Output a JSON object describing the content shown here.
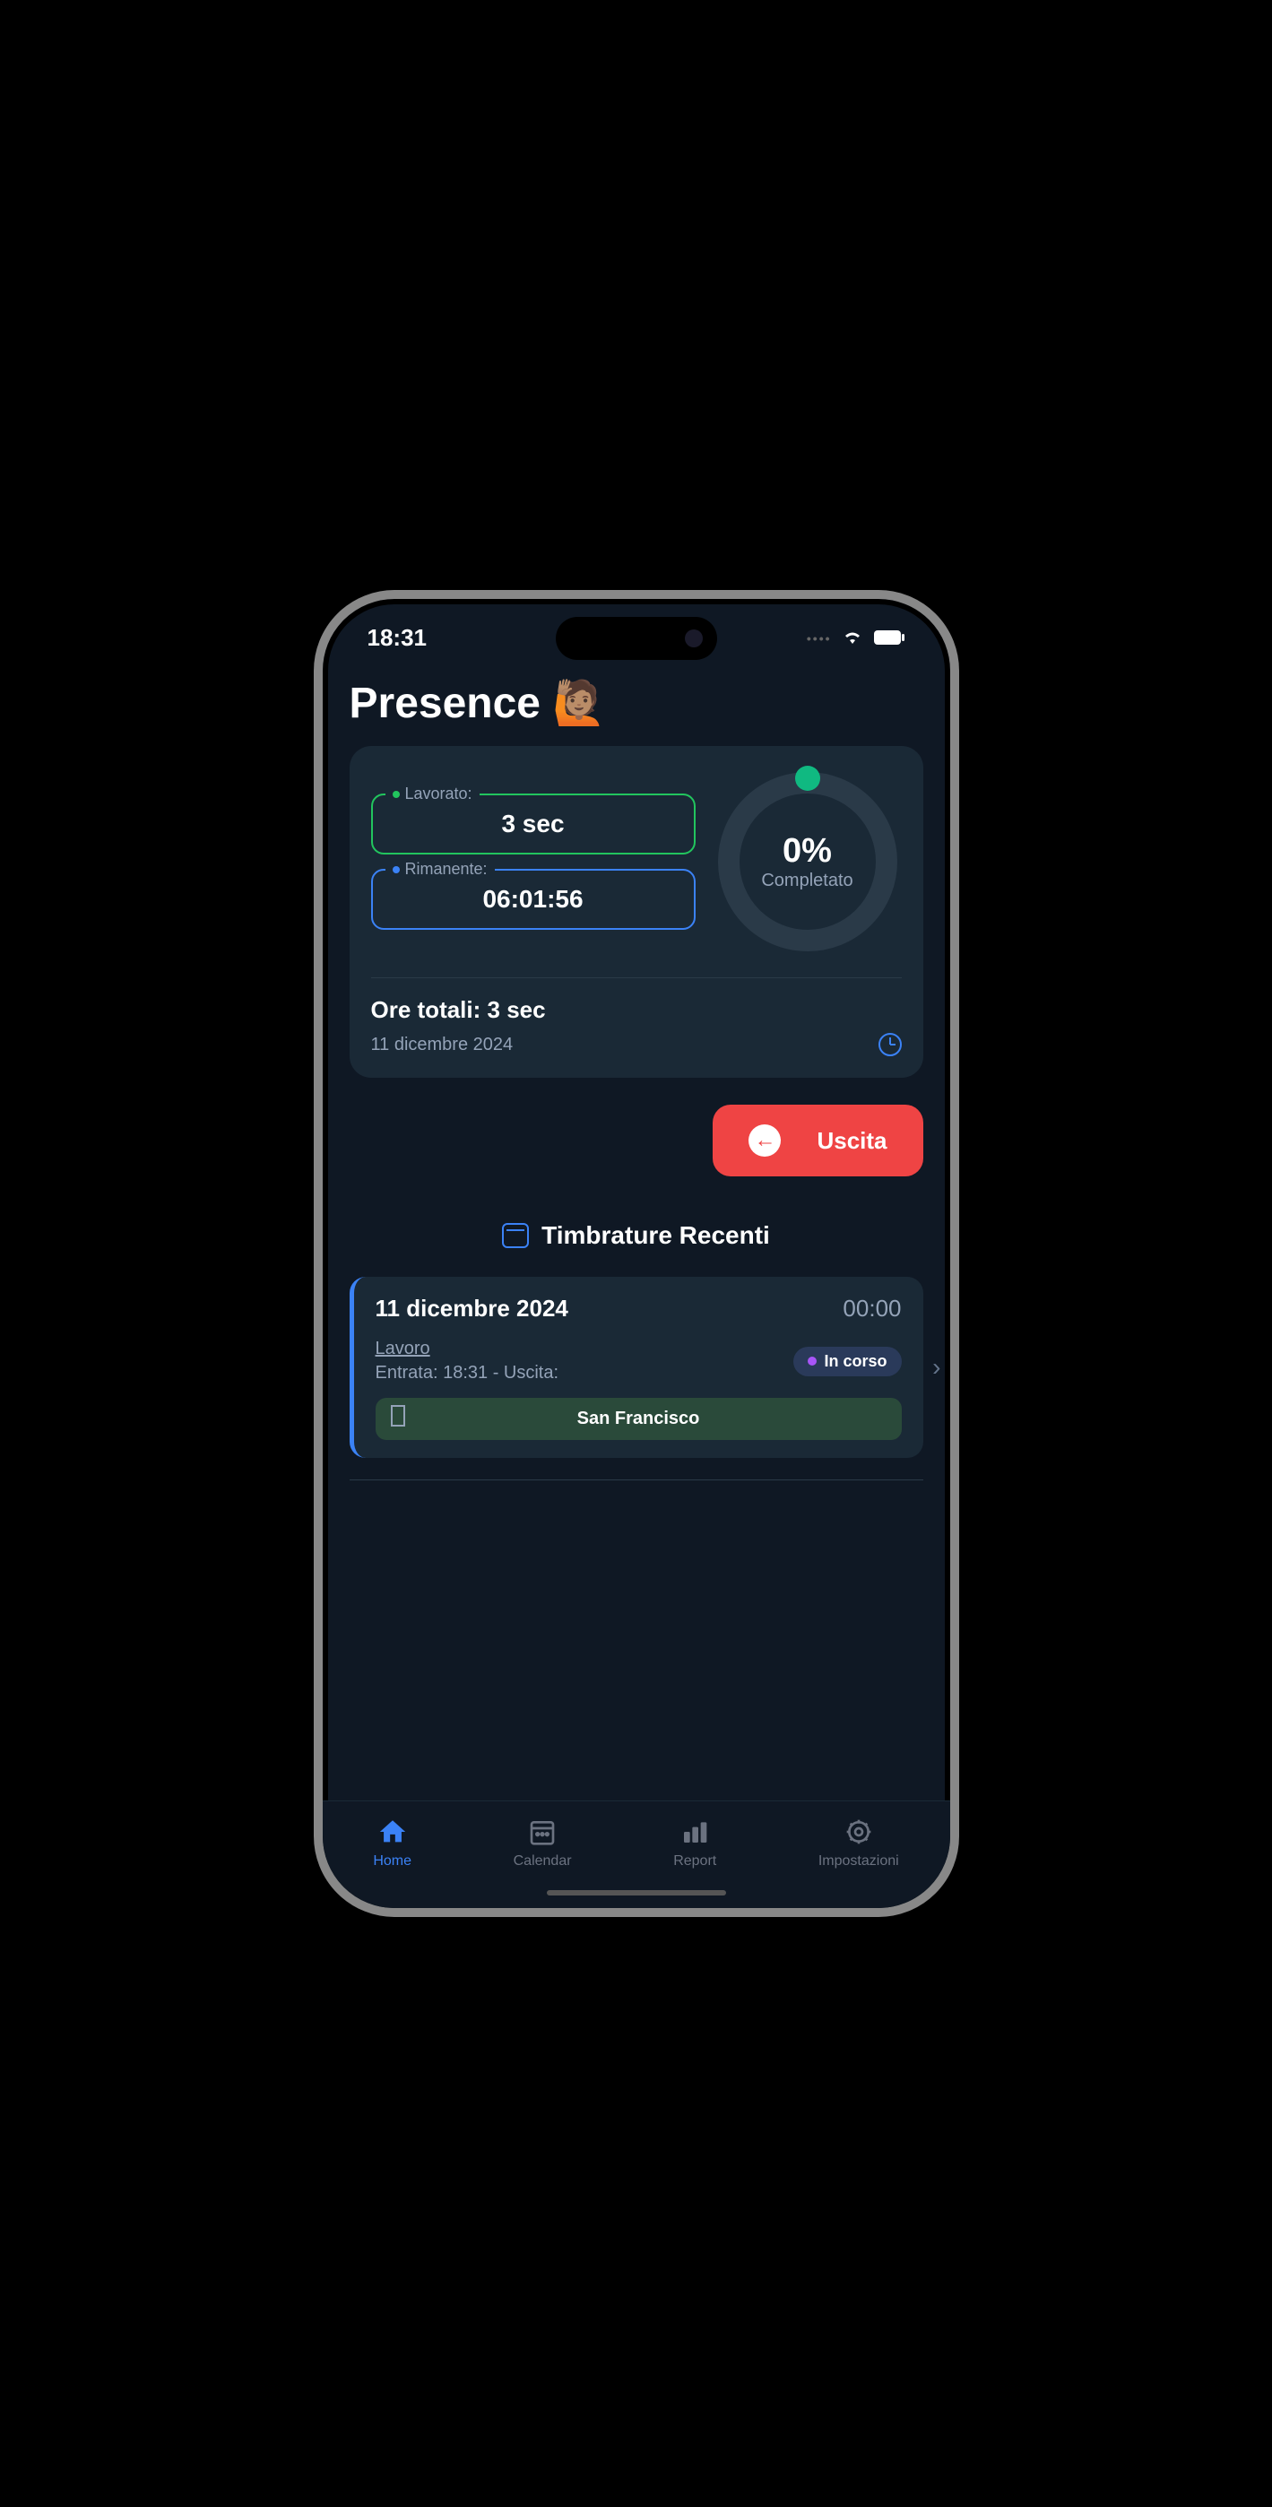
{
  "status_bar": {
    "time": "18:31"
  },
  "app": {
    "title": "Presence 🙋🏽"
  },
  "summary": {
    "worked_label": "Lavorato:",
    "worked_value": "3 sec",
    "remaining_label": "Rimanente:",
    "remaining_value": "06:01:56",
    "progress_percent": "0%",
    "progress_label": "Completato",
    "total_hours": "Ore totali: 3 sec",
    "date": "11 dicembre 2024"
  },
  "exit_button": {
    "label": "Uscita"
  },
  "recent": {
    "title": "Timbrature Recenti",
    "records": [
      {
        "date": "11 dicembre 2024",
        "duration": "00:00",
        "work_label": "Lavoro",
        "times": "Entrata: 18:31 - Uscita:",
        "status": "In corso",
        "location": "San Francisco"
      }
    ]
  },
  "tabs": {
    "home": "Home",
    "calendar": "Calendar",
    "report": "Report",
    "settings": "Impostazioni"
  }
}
